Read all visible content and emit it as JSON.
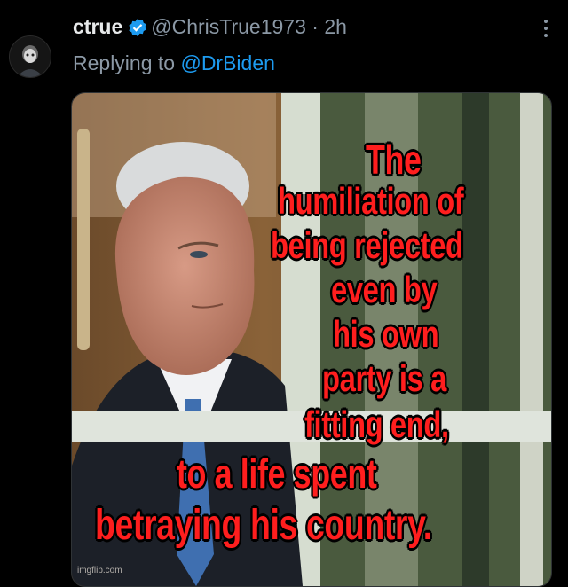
{
  "tweet": {
    "display_name": "ctrue",
    "handle": "@ChrisTrue1973",
    "separator": "·",
    "time": "2h",
    "replying_prefix": "Replying to",
    "replying_to": "@DrBiden"
  },
  "meme": {
    "lines": [
      "The",
      "humiliation of",
      "being rejected",
      "even by",
      "his own",
      "party is a",
      "fitting end,",
      "to a life spent",
      "betraying his country."
    ],
    "watermark": "imgflip.com"
  },
  "colors": {
    "background": "#000000",
    "text": "#e7e9ea",
    "muted": "#8b98a5",
    "link": "#1d9bf0",
    "verified": "#1d9bf0",
    "meme_text": "#ff1e1e"
  },
  "icons": [
    "avatar",
    "verified-badge-icon",
    "more-icon"
  ]
}
